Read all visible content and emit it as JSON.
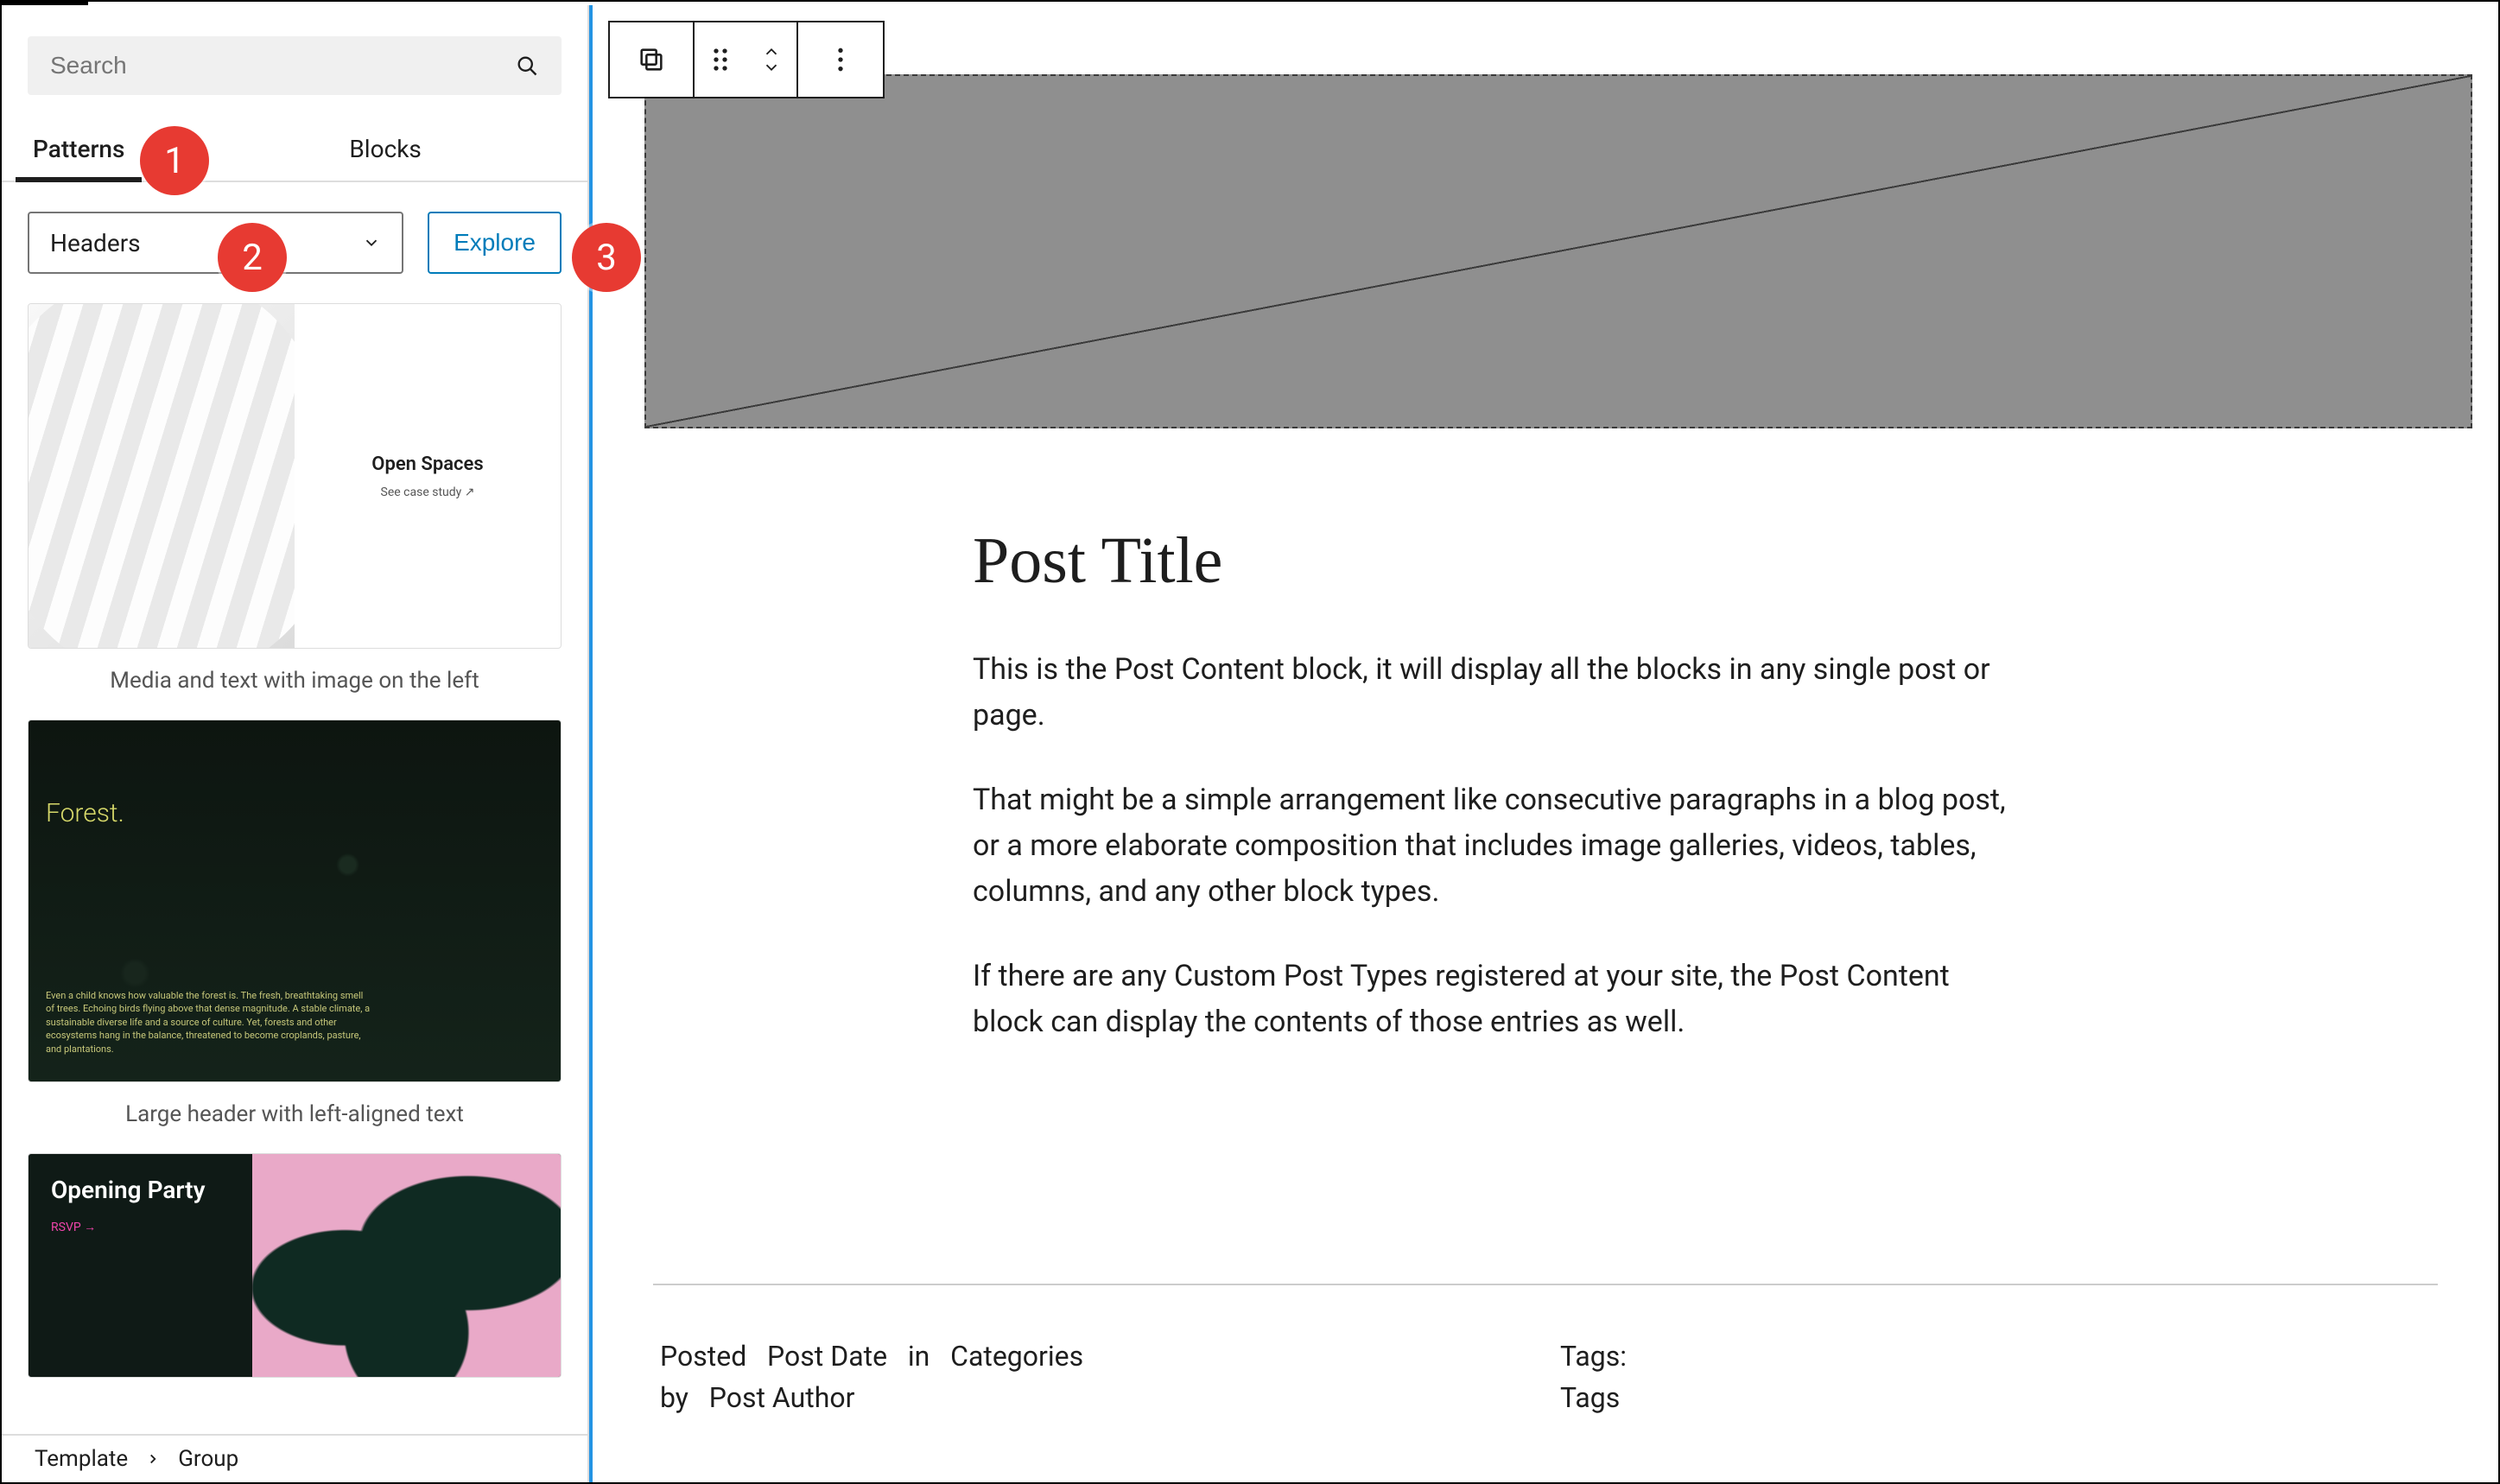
{
  "sidebar": {
    "search_placeholder": "Search",
    "tabs": {
      "patterns": "Patterns",
      "blocks": "Blocks"
    },
    "category_selected": "Headers",
    "explore_label": "Explore",
    "patterns": [
      {
        "caption": "Media and text with image on the left",
        "preview": {
          "title": "Open Spaces",
          "subtitle": "See case study ↗"
        }
      },
      {
        "caption": "Large header with left-aligned text",
        "preview": {
          "title": "Forest.",
          "desc": "Even a child knows how valuable the forest is. The fresh, breathtaking smell of trees. Echoing birds flying above that dense magnitude. A stable climate, a sustainable diverse life and a source of culture. Yet, forests and other ecosystems hang in the balance, threatened to become croplands, pasture, and plantations."
        }
      },
      {
        "caption": "",
        "preview": {
          "title": "Opening Party",
          "subtitle": "RSVP →"
        }
      }
    ]
  },
  "breadcrumb": {
    "root": "Template",
    "current": "Group"
  },
  "badges": {
    "one": "1",
    "two": "2",
    "three": "3"
  },
  "canvas": {
    "post_title": "Post Title",
    "para1": "This is the Post Content block, it will display all the blocks in any single post or page.",
    "para2": "That might be a simple arrangement like consecutive paragraphs in a blog post, or a more elaborate composition that includes image galleries, videos, tables, columns, and any other block types.",
    "para3": "If there are any Custom Post Types registered at your site, the Post Content block can display the contents of those entries as well.",
    "meta": {
      "posted_label": "Posted",
      "post_date": "Post Date",
      "in_label": "in",
      "categories": "Categories",
      "by_label": "by",
      "post_author": "Post Author",
      "tags_label": "Tags:",
      "tags_value": "Tags"
    }
  }
}
